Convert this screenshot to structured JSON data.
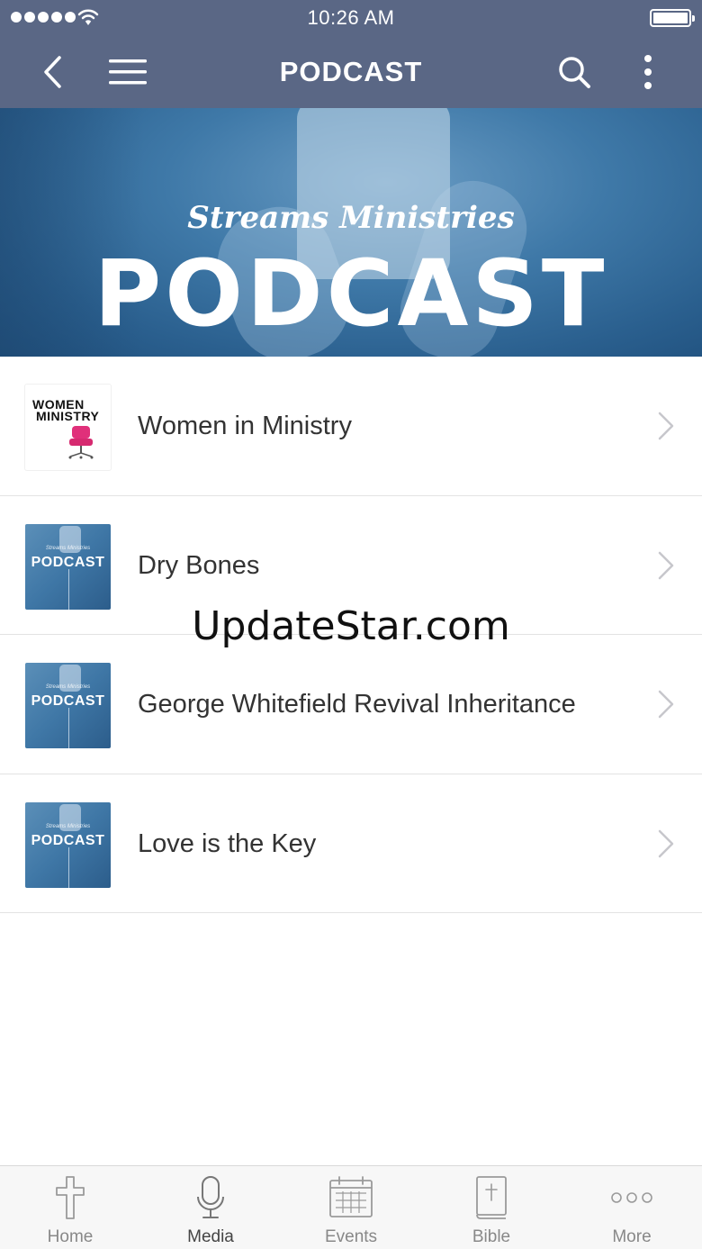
{
  "status_bar": {
    "time": "10:26 AM"
  },
  "nav": {
    "title": "PODCAST"
  },
  "banner": {
    "subtitle": "Streams Ministries",
    "title": "PODCAST"
  },
  "items": [
    {
      "title": "Women in Ministry",
      "thumb_line1": "WOMEN",
      "thumb_line2": "MINISTRY"
    },
    {
      "title": "Dry Bones",
      "thumb_text": "PODCAST",
      "thumb_small": "Streams Ministries"
    },
    {
      "title": "George Whitefield Revival Inheritance",
      "thumb_text": "PODCAST",
      "thumb_small": "Streams Ministries"
    },
    {
      "title": "Love is the Key",
      "thumb_text": "PODCAST",
      "thumb_small": "Streams Ministries"
    }
  ],
  "watermark": "UpdateStar.com",
  "tabs": [
    {
      "label": "Home",
      "icon": "cross-icon"
    },
    {
      "label": "Media",
      "icon": "microphone-icon"
    },
    {
      "label": "Events",
      "icon": "calendar-icon"
    },
    {
      "label": "Bible",
      "icon": "bible-icon"
    },
    {
      "label": "More",
      "icon": "more-dots-icon"
    }
  ],
  "colors": {
    "nav_bg": "#5a6785",
    "banner_blue": "#3f79a8",
    "tab_bg": "#f7f7f7"
  }
}
